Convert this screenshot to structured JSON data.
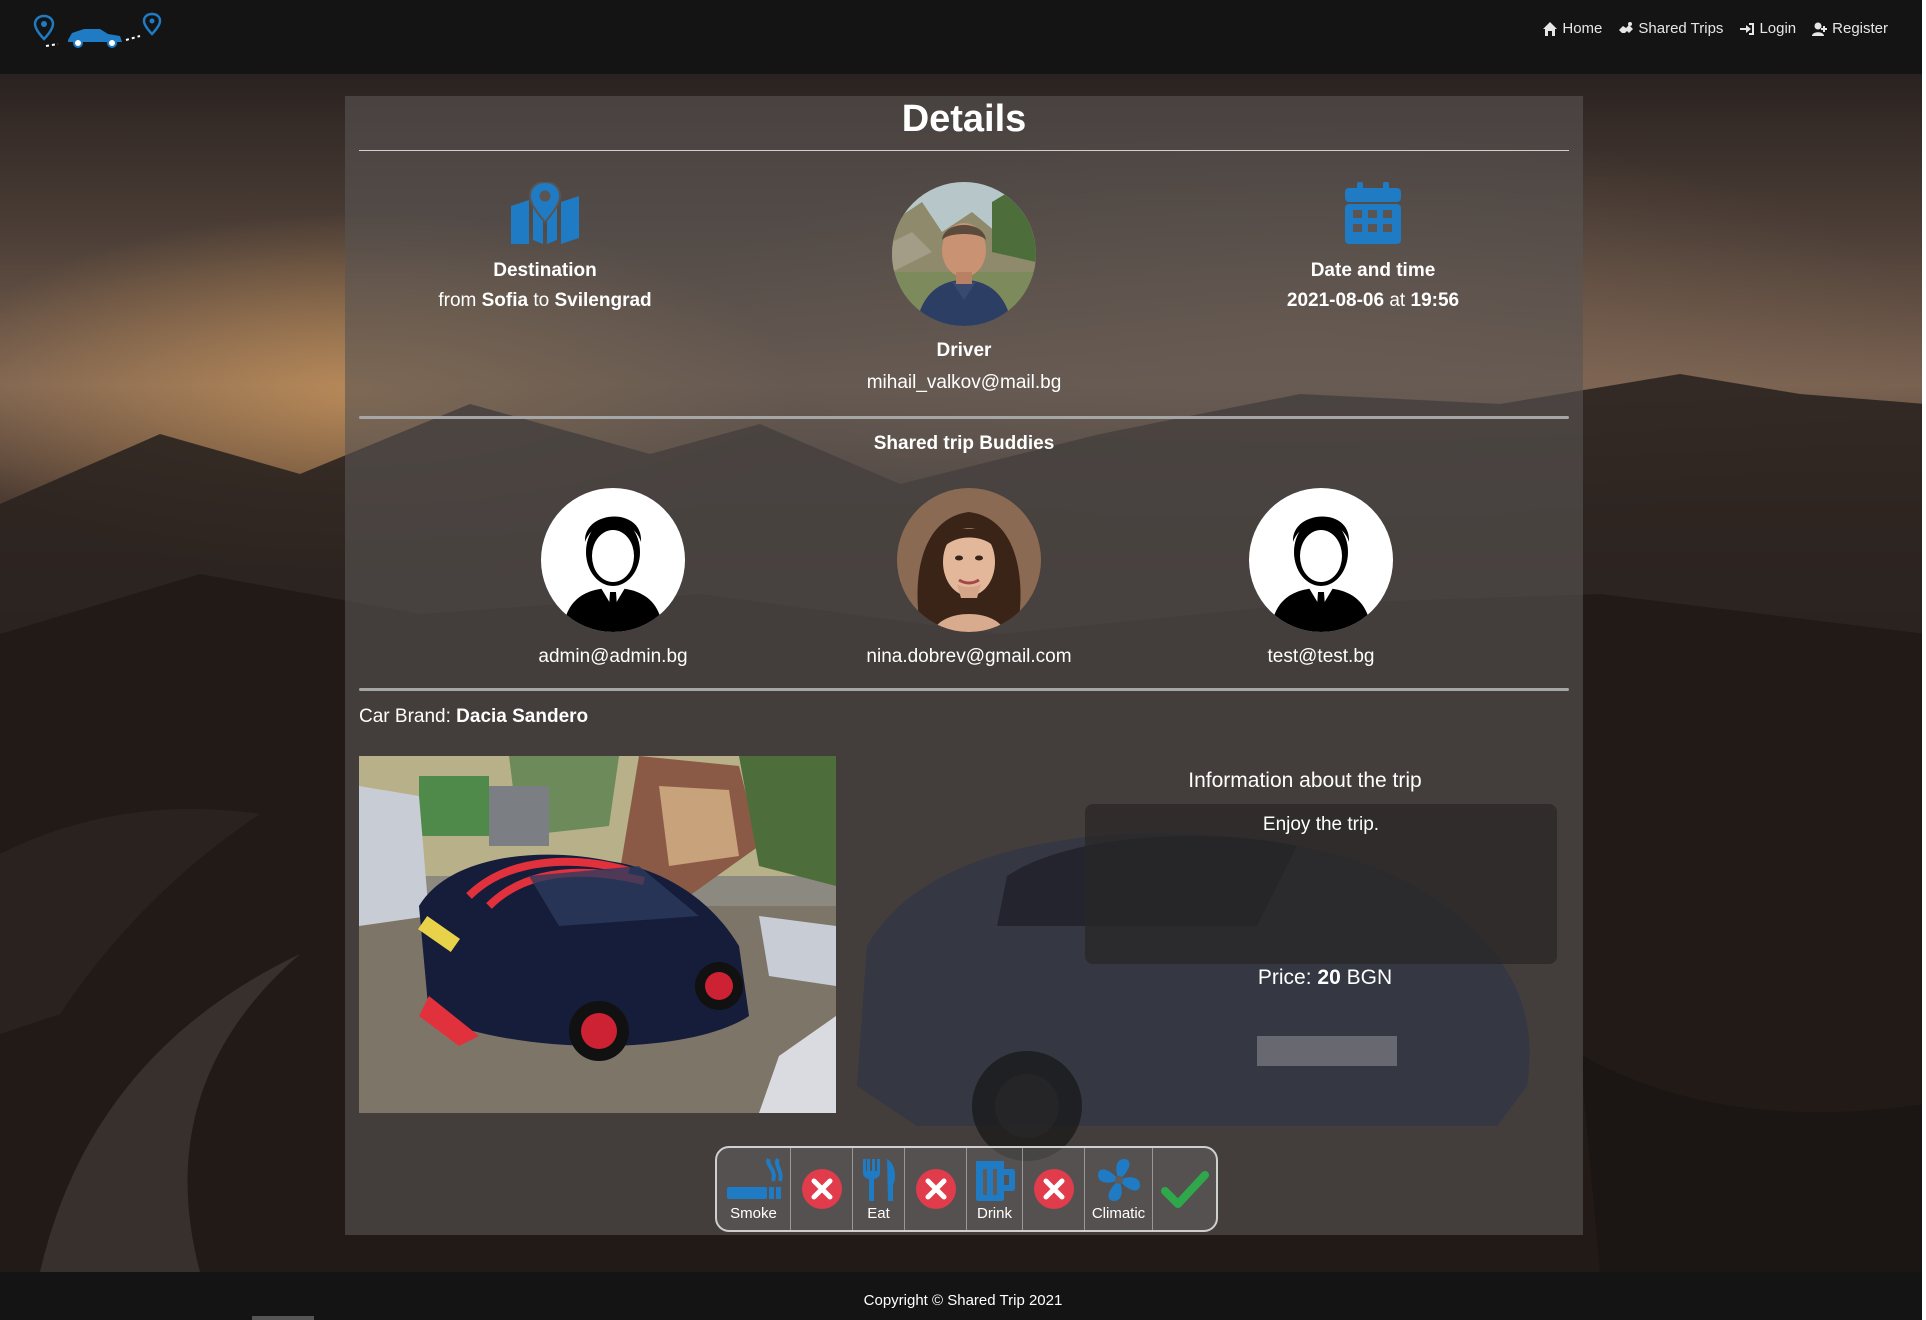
{
  "navbar": {
    "logo_icon": "map-pin-car-logo",
    "items": [
      {
        "label": "Home",
        "icon": "home-icon"
      },
      {
        "label": "Shared Trips",
        "icon": "handshake-icon"
      },
      {
        "label": "Login",
        "icon": "sign-in-icon"
      },
      {
        "label": "Register",
        "icon": "user-plus-icon"
      }
    ]
  },
  "details": {
    "title": "Details",
    "destination": {
      "label": "Destination",
      "from_word": "from",
      "from": "Sofia",
      "to_word": "to",
      "to": "Svilengrad",
      "icon": "map-marked-icon"
    },
    "driver": {
      "label": "Driver",
      "email": "mihail_valkov@mail.bg"
    },
    "datetime": {
      "label": "Date and time",
      "date": "2021-08-06",
      "at_word": "at",
      "time": "19:56",
      "icon": "calendar-icon"
    }
  },
  "buddies": {
    "title": "Shared trip Buddies",
    "items": [
      {
        "email": "admin@admin.bg",
        "avatar": "default-user-avatar"
      },
      {
        "email": "nina.dobrev@gmail.com",
        "avatar": "photo-avatar"
      },
      {
        "email": "test@test.bg",
        "avatar": "default-user-avatar"
      }
    ]
  },
  "car": {
    "brand_label": "Car Brand:",
    "brand": "Dacia Sandero"
  },
  "trip_info": {
    "title": "Information about the trip",
    "description": "Enjoy the trip.",
    "price_label": "Price:",
    "price_value": "20",
    "price_currency": "BGN"
  },
  "features": [
    {
      "label": "Smoke",
      "icon": "smoking-icon",
      "allowed": false
    },
    {
      "label": "Eat",
      "icon": "utensils-icon",
      "allowed": false
    },
    {
      "label": "Drink",
      "icon": "beer-mug-icon",
      "allowed": false
    },
    {
      "label": "Climatic",
      "icon": "fan-icon",
      "allowed": true
    }
  ],
  "colors": {
    "accent_blue": "#1e7bc4",
    "no_red": "#e03c4c",
    "yes_green": "#2ea84a"
  },
  "footer": {
    "copyright": "Copyright © Shared Trip 2021"
  }
}
